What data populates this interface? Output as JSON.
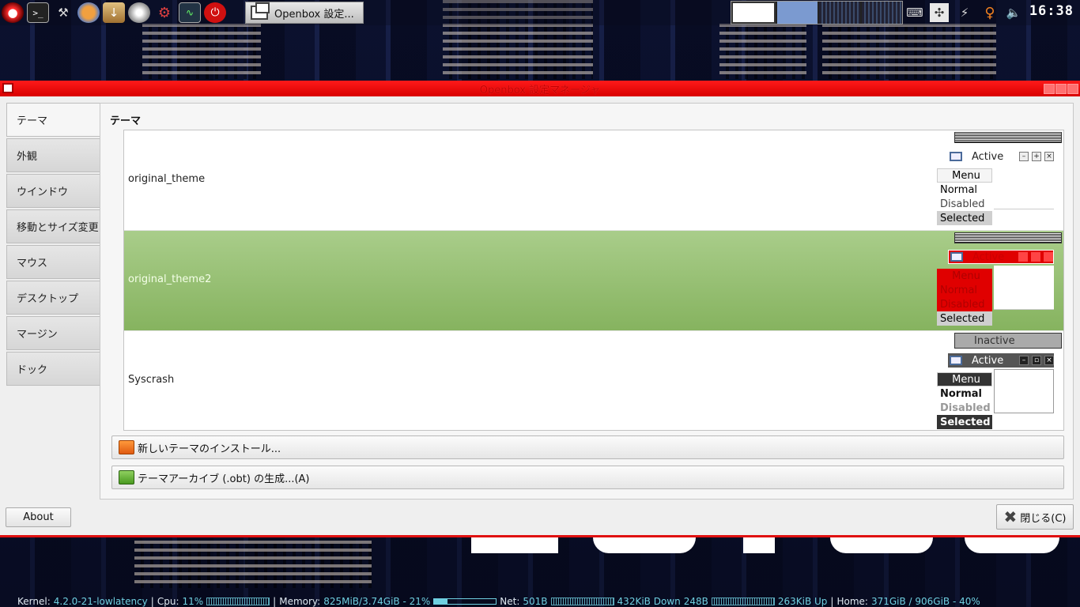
{
  "window": {
    "title": "Openbox 設定マネージャ"
  },
  "top_panel": {
    "task_label": "Openbox 設定...",
    "clock": "16:38"
  },
  "sidebar": {
    "items": [
      {
        "label": "テーマ",
        "active": true
      },
      {
        "label": "外観"
      },
      {
        "label": "ウインドウ"
      },
      {
        "label": "移動とサイズ変更"
      },
      {
        "label": "マウス"
      },
      {
        "label": "デスクトップ"
      },
      {
        "label": "マージン"
      },
      {
        "label": "ドック"
      }
    ]
  },
  "main": {
    "section_title": "テーマ",
    "themes": [
      {
        "name": "original_theme",
        "selected": false
      },
      {
        "name": "original_theme2",
        "selected": true
      },
      {
        "name": "Syscrash",
        "selected": false
      }
    ],
    "preview": {
      "inactive_label": "Inactive",
      "active_label": "Active",
      "menu_title": "Menu",
      "normal_item": "Normal",
      "disabled_item": "Disabled",
      "selected_item": "Selected"
    },
    "install_button": "新しいテーマのインストール...",
    "archive_button": "テーマアーカイブ (.obt) の生成...(A)"
  },
  "footer": {
    "about_button": "About",
    "close_button": "閉じる(C)"
  },
  "conky": {
    "kernel_label": "Kernel:",
    "kernel_value": "4.2.0-21-lowlatency",
    "cpu_label": "Cpu:",
    "cpu_value": "11%",
    "memory_label": "Memory:",
    "memory_value": "825MiB/3.74GiB - 21%",
    "memory_fraction": 0.21,
    "net_label": "Net:",
    "net_value": "501B",
    "down_value": "432KiB Down",
    "down_extra": "248B",
    "up_value": "263KiB Up",
    "home_label": "Home:",
    "home_value": "371GiB / 906GiB - 40%"
  },
  "colors": {
    "titlebar": "#e00000",
    "selected_row": "#9cc27a",
    "conky_value": "#6fcfe0"
  }
}
